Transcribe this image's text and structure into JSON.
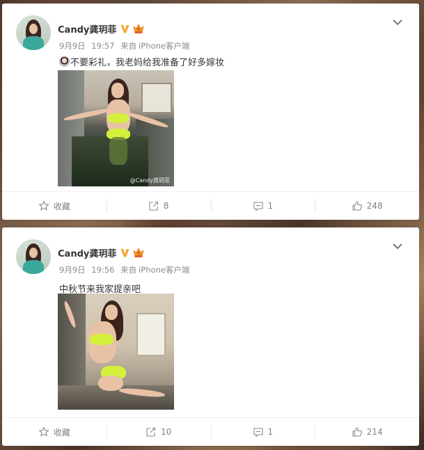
{
  "posts": [
    {
      "user": "Candy龚玥菲",
      "date": "9月9日",
      "time": "19:57",
      "source_prefix": "来自",
      "source": "iPhone客户端",
      "text": "不要彩礼，我老妈给我准备了好多嫁妆",
      "has_sticker": true,
      "photo_watermark": "@Candy龚玥菲",
      "actions": {
        "favorite_label": "收藏",
        "repost_count": "8",
        "comment_count": "1",
        "like_count": "248"
      }
    },
    {
      "user": "Candy龚玥菲",
      "date": "9月9日",
      "time": "19:56",
      "source_prefix": "来自",
      "source": "iPhone客户端",
      "text": "中秋节来我家提亲吧",
      "has_sticker": false,
      "actions": {
        "favorite_label": "收藏",
        "repost_count": "10",
        "comment_count": "1",
        "like_count": "214"
      }
    }
  ],
  "colors": {
    "text_primary": "#333333",
    "text_meta": "#808080",
    "verified_badge": "#f5a623",
    "bikini": "#d4f03a"
  },
  "icons": [
    "chevron-down-icon",
    "verified-v-icon",
    "crown-badge-icon",
    "star-icon",
    "repost-icon",
    "comment-icon",
    "like-icon"
  ]
}
